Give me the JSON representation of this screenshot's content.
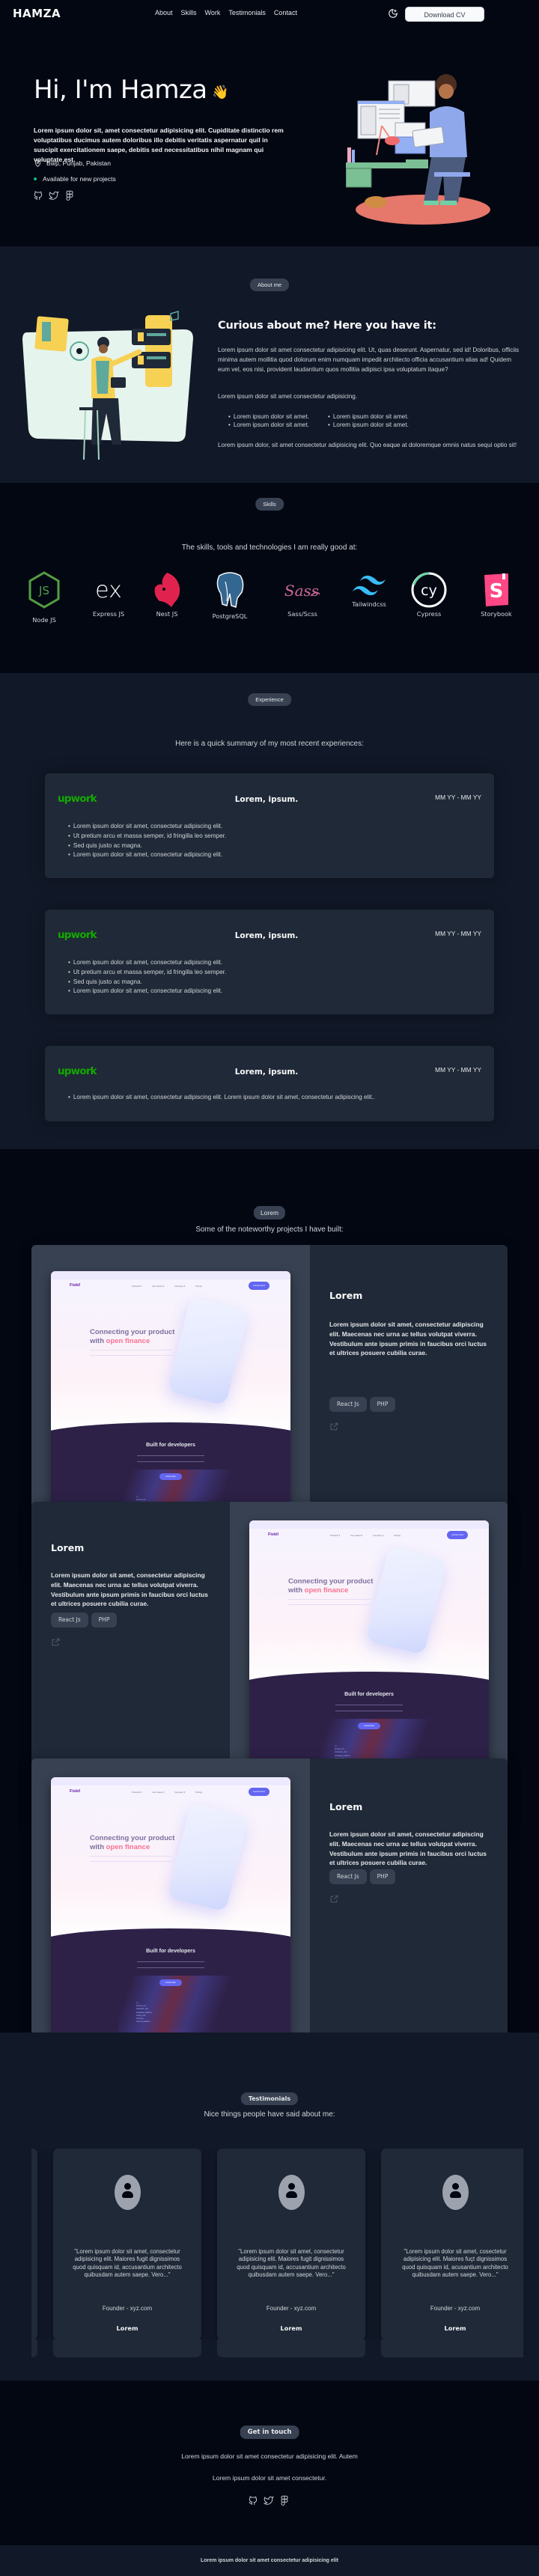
{
  "nav": {
    "logo": "HAMZA",
    "links": [
      "About",
      "Skills",
      "Work",
      "Testimonials",
      "Contact"
    ],
    "theme_toggle_icon": "moon-icon",
    "download_cv": "Download CV"
  },
  "hero": {
    "title": "Hi, I'm Hamza",
    "wave_emoji": "👋",
    "description": "Lorem ipsum dolor sit, amet consectetur adipisicing elit. Cupiditate distinctio rem voluptatibus ducimus autem doloribus illo debitis veritatis aspernatur quil in suscipit exercitationem saepe, debitis sed necessitatibus nihil magnam qui voluptate est.",
    "location": "Bwp, Punjab, Pakistan",
    "availability": "Available for new projects",
    "status_color": "#10b981",
    "socials": [
      "github-icon",
      "twitter-icon",
      "figma-icon"
    ]
  },
  "about": {
    "badge": "About me",
    "title": "Curious about me? Here you have it:",
    "paragraph1": "Lorem ipsum dolor sit amet consectetur adipisicing elit. Ut, quas deserunt. Aspernatur, sed id! Doloribus, officiis minima autem mollitia quod dolorum enim numquam impedit architecto officia accusantium alias ad! Quidem eum vel, eos nisi, provident laudantium quos mollitia adipisci ipsa voluptatum itaque?",
    "paragraph2": "Lorem ipsum dolor sit amet consectetur adipisicing.",
    "list": [
      "Lorem ipsum dolor sit amet.",
      "Lorem ipsum dolor sit amet.",
      "Lorem ipsum dolor sit amet.",
      "Lorem ipsum dolor sit amet."
    ],
    "paragraph3": "Lorem ipsum dolor, sit amet consectetur adipisicing elit. Quo eaque at doloremque omnis natus sequi optio sit!"
  },
  "skills": {
    "badge": "Skills",
    "subtitle": "The skills, tools and technologies I am really good at:",
    "items": [
      {
        "label": "Node JS",
        "icon": "nodejs-icon"
      },
      {
        "label": "Express JS",
        "icon": "express-icon"
      },
      {
        "label": "Nest JS",
        "icon": "nestjs-icon"
      },
      {
        "label": "PostgreSQL",
        "icon": "postgresql-icon"
      },
      {
        "label": "Sass/Scss",
        "icon": "sass-icon"
      },
      {
        "label": "Tailwindcss",
        "icon": "tailwind-icon"
      },
      {
        "label": "Cypress",
        "icon": "cypress-icon"
      },
      {
        "label": "Storybook",
        "icon": "storybook-icon"
      }
    ]
  },
  "experience": {
    "badge": "Experience",
    "subtitle": "Here is a quick summary of my most recent experiences:",
    "brand_color": "#14a800",
    "items": [
      {
        "company": "upwork",
        "role": "Lorem, ipsum.",
        "date": "MM YY - MM YY",
        "bullets": [
          "Lorem ipsum dolor sit amet, consectetur adipiscing elit.",
          "Ut pretium arcu et massa semper, id fringilla leo semper.",
          "Sed quis justo ac magna.",
          "Lorem ipsum dolor sit amet, consectetur adipiscing elit."
        ]
      },
      {
        "company": "upwork",
        "role": "Lorem, ipsum.",
        "date": "MM YY - MM YY",
        "bullets": [
          "Lorem ipsum dolor sit amet, consectetur adipiscing elit.",
          "Ut pretium arcu et massa semper, id fringilla leo semper.",
          "Sed quis justo ac magna.",
          "Lorem ipsum dolor sit amet, consectetur adipiscing elit."
        ]
      },
      {
        "company": "upwork",
        "role": "Lorem, ipsum.",
        "date": "MM YY - MM YY",
        "bullets": [
          "Lorem ipsum dolor sit amet, consectetur adipiscing elit. Lorem ipsum dolor sit amet, consectetur adipiscing elit.."
        ]
      }
    ]
  },
  "projects": {
    "badge": "Lorem",
    "subtitle": "Some of the noteworthy projects I have built:",
    "mockup": {
      "logo": "Fiskil",
      "nav": [
        "Products ▾",
        "Use Cases ▾",
        "Company ▾",
        "Pricing"
      ],
      "cta": "Contact Now",
      "headline_1": "Connecting your product",
      "headline_2a": "with ",
      "headline_2b": "open finance",
      "section_title": "Built for developers"
    },
    "items": [
      {
        "title": "Lorem",
        "description": "Lorem ipsum dolor sit amet, consectetur adipiscing elit. Maecenas nec urna ac tellus volutpat viverra. Vestibulum ante ipsum primis in faucibus orci luctus et ultrices posuere cubilia curae.",
        "tags": [
          "React Js",
          "PHP"
        ],
        "link_icon": "external-link-icon"
      },
      {
        "title": "Lorem",
        "description": "Lorem ipsum dolor sit amet, consectetur adipiscing elit. Maecenas nec urna ac tellus volutpat viverra. Vestibulum ante ipsum primis in faucibus orci luctus et ultrices posuere cubilia curae.",
        "tags": [
          "React Js",
          "PHP"
        ],
        "link_icon": "external-link-icon"
      },
      {
        "title": "Lorem",
        "description": "Lorem ipsum dolor sit amet, consectetur adipiscing elit. Maecenas nec urna ac tellus volutpat viverra. Vestibulum ante ipsum primis in faucibus orci luctus et ultrices posuere cubilia curae.",
        "tags": [
          "React Js",
          "PHP"
        ],
        "link_icon": "external-link-icon"
      }
    ]
  },
  "testimonials": {
    "badge": "Testimonials",
    "subtitle": "Nice things people have said about me:",
    "items": [
      {
        "quote": "\"Lorem ipsum dolor sit amet, consectetur adipisicing elit. Maiores fugit dignissimos quod quisquam id, accusantium architecto quibusdam autem saepe. Vero...\"",
        "name": "Lorem",
        "role": "Founder - xyz.com"
      },
      {
        "quote": "\"Lorem ipsum dolor sit amet, consectetur adipisicing elit. Maiores fugit dignissimos quod quisquam id, accusantium architecto quibusdam autem saepe. Vero...\"",
        "name": "Lorem",
        "role": "Founder - xyz.com"
      },
      {
        "quote": "\"Lorem ipsum dolor sit amet, cosectetur adipisicing elit. Maiores fuçt dignissimos quod quisquam id, acusantium architecto quibusdam autem saepe. Vero...\"",
        "name": "Lorem",
        "role": "Founder - xyz.com"
      }
    ]
  },
  "contact": {
    "badge": "Get in touch",
    "paragraph1": "Lorem ipsum dolor sit amet consectetur adipisicing elit. Autem",
    "paragraph2": "Lorem ipsum dolor sit amet consectetur.",
    "socials": [
      "github-icon",
      "twitter-icon",
      "figma-icon"
    ]
  },
  "footer": {
    "text": "Lorem ipsum dolor sit amet consectetur adipisicing elit"
  }
}
